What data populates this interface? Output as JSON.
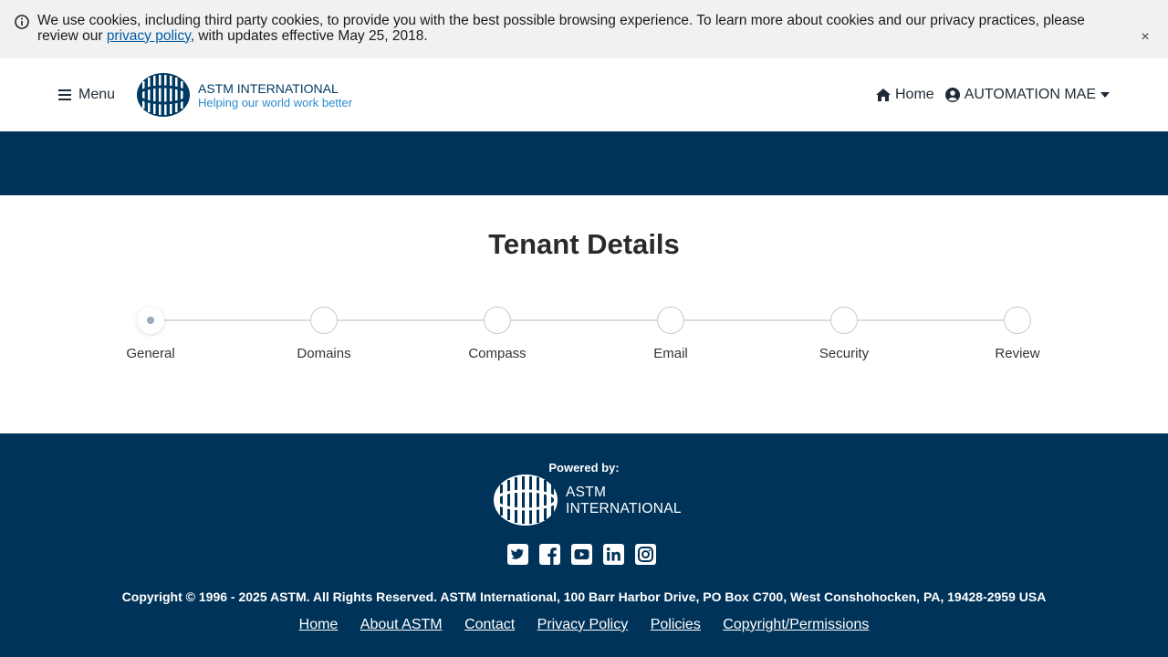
{
  "cookie_banner": {
    "text_before": "We use cookies, including third party cookies, to provide you with the best possible browsing experience. To learn more about cookies and our privacy practices, please review our ",
    "link_text": "privacy policy",
    "text_after": ", with updates effective May 25, 2018.",
    "close_label": "×",
    "icon": "info-circle-icon"
  },
  "header": {
    "menu_label": "Menu",
    "brand_name": "ASTM INTERNATIONAL",
    "brand_tagline": "Helping our world work better",
    "home_label": "Home",
    "user_label": "AUTOMATION MAE"
  },
  "page": {
    "title": "Tenant Details"
  },
  "stepper": {
    "active_index": 0,
    "steps": [
      "General",
      "Domains",
      "Compass",
      "Email",
      "Security",
      "Review"
    ]
  },
  "footer": {
    "powered_by": "Powered by:",
    "brand_line1": "ASTM",
    "brand_line2": "INTERNATIONAL",
    "social": [
      "twitter-icon",
      "facebook-icon",
      "youtube-icon",
      "linkedin-icon",
      "instagram-icon"
    ],
    "copyright": "Copyright © 1996 - 2025 ASTM. All Rights Reserved. ASTM International, 100 Barr Harbor Drive, PO Box C700, West Conshohocken, PA, 19428-2959 USA",
    "links": [
      "Home",
      "About ASTM",
      "Contact",
      "Privacy Policy",
      "Policies",
      "Copyright/Permissions"
    ]
  },
  "colors": {
    "navy": "#003359",
    "link_blue": "#005ea8",
    "tagline_blue": "#2b8ccf",
    "banner_bg": "#f1f1f1"
  }
}
